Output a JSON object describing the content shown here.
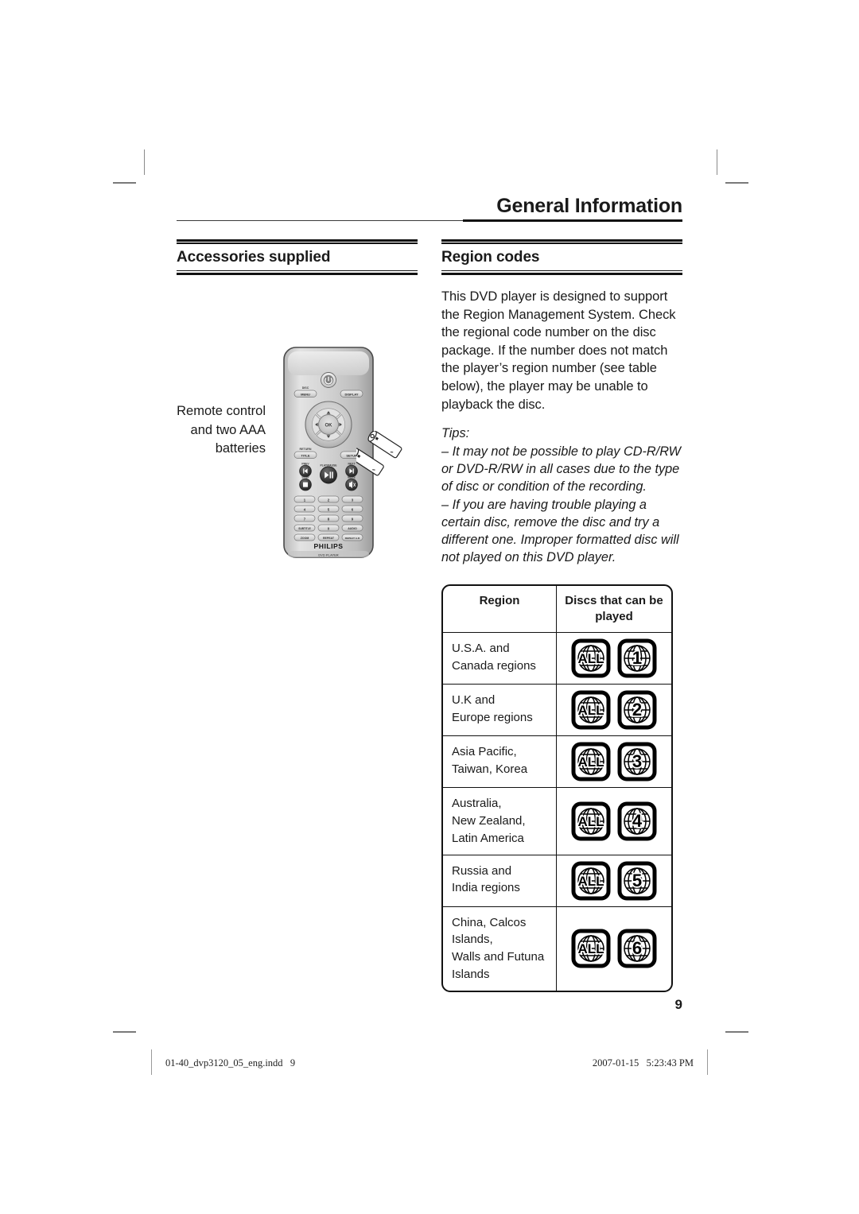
{
  "running_head": "General Information",
  "page_number": "9",
  "left_column": {
    "section_title": "Accessories supplied",
    "caption": "Remote control and two AAA batteries",
    "remote": {
      "brand": "PHILIPS",
      "model_label": "DVD PLAYER",
      "buttons": {
        "power": "power-icon",
        "disc_menu_top": "DISC",
        "disc_menu_bottom": "MENU",
        "display": "DISPLAY",
        "ok": "OK",
        "return_top": "RETURN",
        "return_bottom": "TITLE",
        "setup": "SETUP",
        "prev_label": "PREV",
        "next_label": "NEXT",
        "play_pause_label": "PLAY/PAUSE",
        "stop_label": "STOP",
        "mute_label": "MUTE",
        "numbers": [
          "1",
          "2",
          "3",
          "4",
          "5",
          "6",
          "7",
          "8",
          "9"
        ],
        "subtitle": "SUBTITLE",
        "zero": "0",
        "audio": "AUDIO",
        "zoom": "ZOOM",
        "repeat": "REPEAT",
        "repeat_ab": "REPEAT A-B"
      }
    }
  },
  "right_column": {
    "section_title": "Region codes",
    "paragraph": "This DVD player is designed to support the Region Management System. Check the regional code number on the disc package. If the number does not match the player’s region number (see table below), the player may be unable to playback the disc.",
    "tips_label": "Tips:",
    "tips": [
      "– It may not be possible to play CD-R/RW or DVD-R/RW in all cases due to the type of disc or condition of the recording.",
      "– If you are having trouble playing a certain disc, remove the disc and try a different one. Improper formatted disc will not played on this DVD player."
    ],
    "table": {
      "headers": [
        "Region",
        "Discs that can be played"
      ],
      "rows": [
        {
          "region": "U.S.A. and\nCanada regions",
          "badges": [
            "ALL",
            "1"
          ]
        },
        {
          "region": "U.K and\nEurope regions",
          "badges": [
            "ALL",
            "2"
          ]
        },
        {
          "region": "Asia Pacific,\nTaiwan, Korea",
          "badges": [
            "ALL",
            "3"
          ]
        },
        {
          "region": "Australia,\nNew Zealand,\nLatin America",
          "badges": [
            "ALL",
            "4"
          ]
        },
        {
          "region": "Russia and\nIndia regions",
          "badges": [
            "ALL",
            "5"
          ]
        },
        {
          "region": "China, Calcos Islands,\nWalls and Futuna\nIslands",
          "badges": [
            "ALL",
            "6"
          ]
        }
      ]
    }
  },
  "footer": {
    "file_name": "01-40_dvp3120_05_eng.indd   9",
    "timestamp": "2007-01-15   5:23:43 PM"
  }
}
